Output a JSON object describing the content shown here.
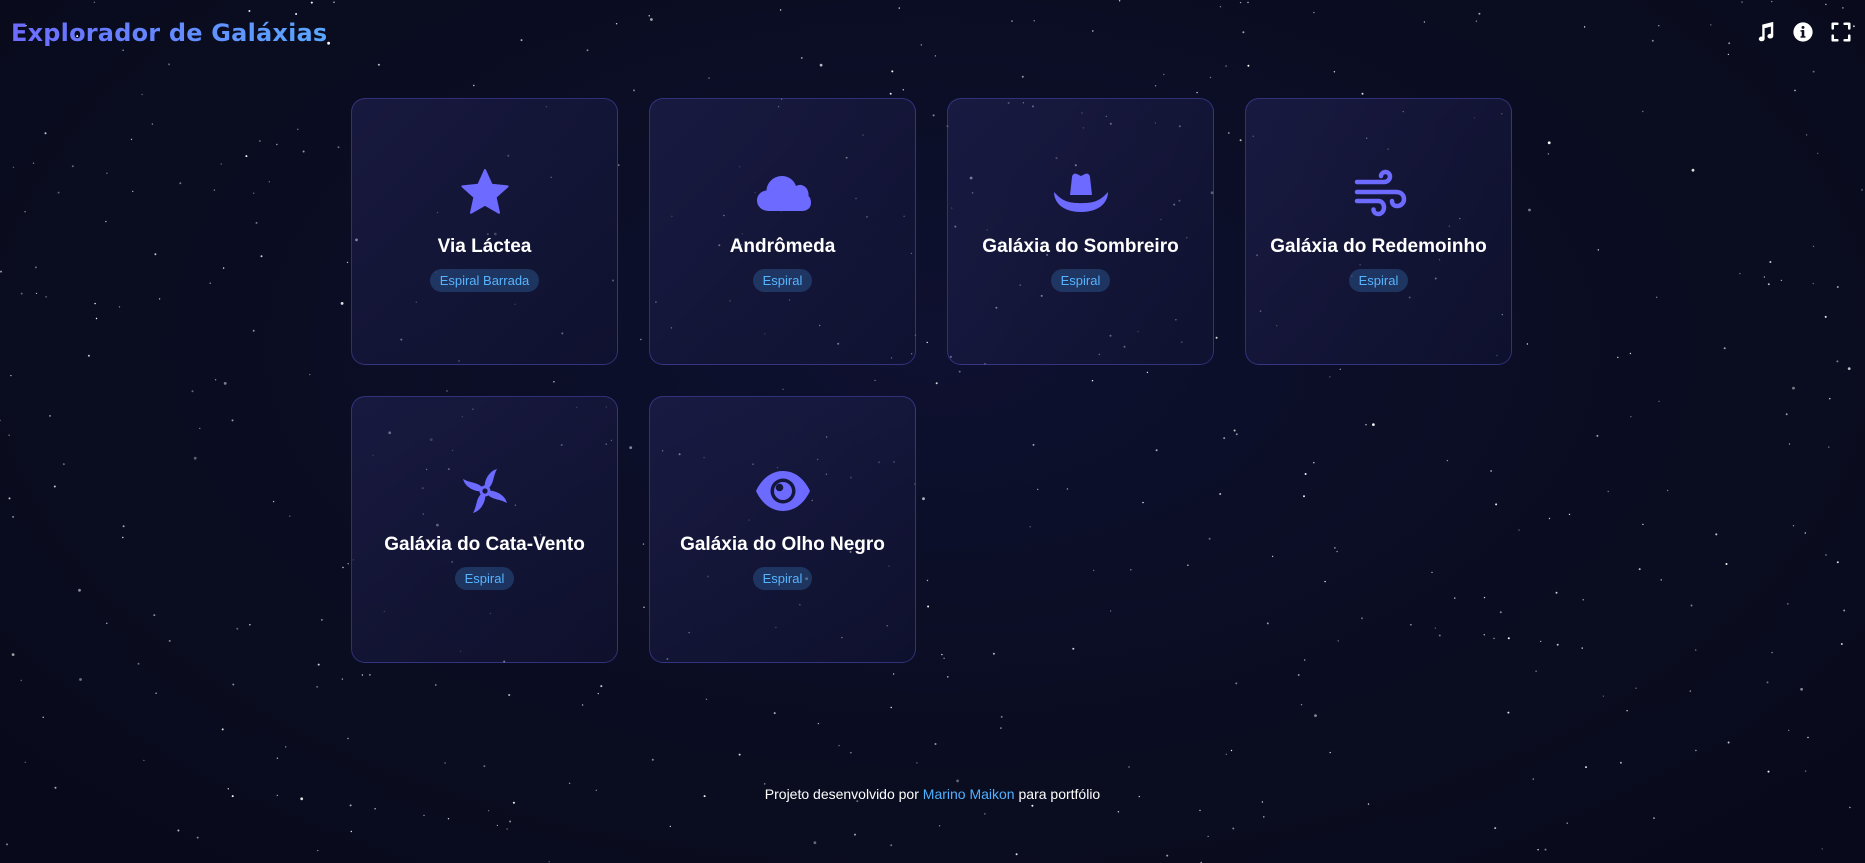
{
  "header": {
    "title": "Explorador de Galáxias"
  },
  "toolbar": {
    "items": [
      {
        "icon": "music-icon",
        "name": "music-button"
      },
      {
        "icon": "info-icon",
        "name": "info-button"
      },
      {
        "icon": "fullscreen-icon",
        "name": "fullscreen-button"
      }
    ]
  },
  "galaxies": [
    {
      "name": "Via Láctea",
      "type": "Espiral Barrada",
      "icon": "star-icon"
    },
    {
      "name": "Andrômeda",
      "type": "Espiral",
      "icon": "cloud-icon"
    },
    {
      "name": "Galáxia do Sombreiro",
      "type": "Espiral",
      "icon": "hat-cowboy-icon"
    },
    {
      "name": "Galáxia do Redemoinho",
      "type": "Espiral",
      "icon": "wind-icon"
    },
    {
      "name": "Galáxia do Cata-Vento",
      "type": "Espiral",
      "icon": "pinwheel-icon"
    },
    {
      "name": "Galáxia do Olho Negro",
      "type": "Espiral",
      "icon": "eye-icon"
    }
  ],
  "footer": {
    "prefix": "Projeto desenvolvido por",
    "author": "Marino Maikon",
    "suffix": "para portfólio"
  },
  "colors": {
    "background": "#0b0d22",
    "accent": "#6c6aff",
    "badge_text": "#57b4ff",
    "link": "#4fb1ff"
  }
}
